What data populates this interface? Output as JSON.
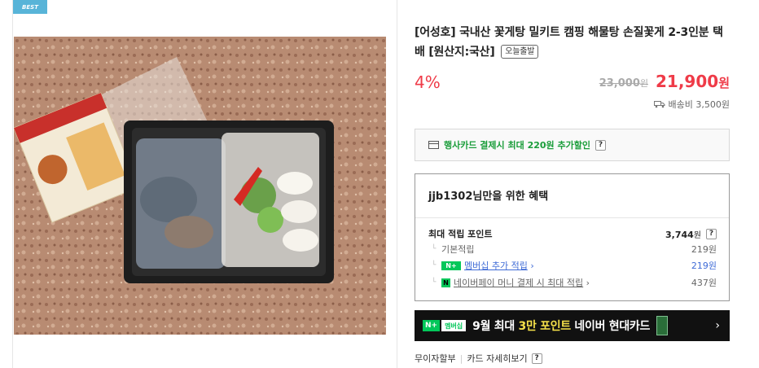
{
  "badge": "BEST",
  "product": {
    "title": "[어성호] 국내산 꽃게탕 밀키트 캠핑 해물탕 손질꽃게 2-3인분 택배 [원산지:국산]",
    "today_badge": "오늘출발",
    "discount": "4%",
    "original_price": "23,000",
    "original_price_unit": "원",
    "sale_price": "21,900",
    "sale_price_unit": "원",
    "shipping": "배송비 3,500원"
  },
  "card_event": {
    "text": "행사카드 결제시 최대 220원 추가할인",
    "help": "?"
  },
  "benefit": {
    "title": "jjb1302님만을 위한 혜택",
    "max_point_label": "최대 적립 포인트",
    "max_point_value": "3,744",
    "max_point_unit": "원",
    "help": "?",
    "rows": [
      {
        "label": "기본적립",
        "value": "219원"
      },
      {
        "badge": "N+",
        "label": "멤버십 추가 적립",
        "value": "219원"
      },
      {
        "badge": "N",
        "label": "네이버페이 머니 결제 시 최대 적립",
        "value": "437원"
      }
    ]
  },
  "banner": {
    "n_badge": "N+",
    "member_badge": "멤버십",
    "text_prefix": "9월 최대 ",
    "text_highlight": "3만 포인트",
    "text_suffix": " 네이버 현대카드",
    "arrow": "›"
  },
  "installment": {
    "label": "무이자할부",
    "detail": "카드 자세히보기",
    "help": "?"
  }
}
